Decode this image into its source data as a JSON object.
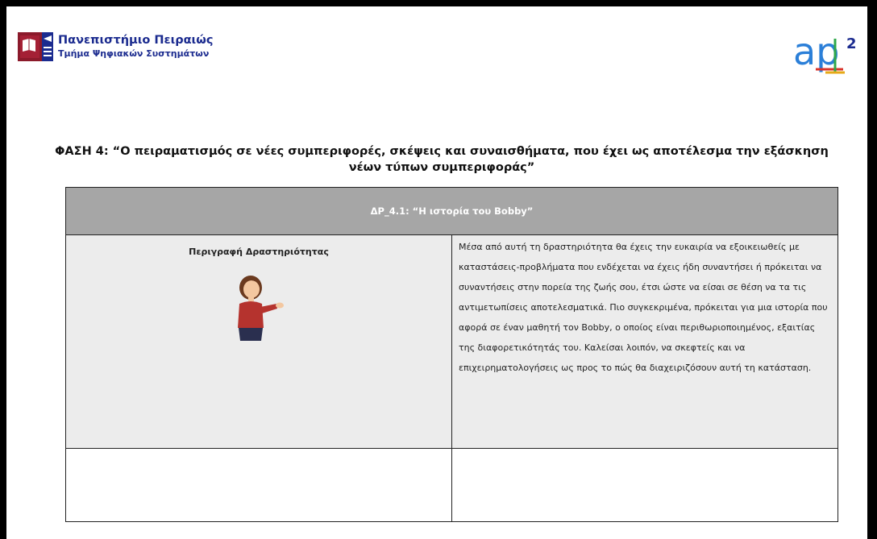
{
  "header": {
    "university_name": "Πανεπιστήμιο Πειραιώς",
    "department": "Τμήμα Ψηφιακών Συστημάτων",
    "apt_logo_text": "ap",
    "apt_logo_exponent": "2"
  },
  "phase_title": "ΦΑΣΗ 4: “Ο πειραματισμός σε νέες συμπεριφορές, σκέψεις και συναισθήματα, που έχει ως αποτέλεσμα την εξάσκηση νέων τύπων συμπεριφοράς”",
  "activity": {
    "header": "ΔΡ_4.1: “Η ιστορία του Bobby”",
    "description_label": "Περιγραφή Δραστηριότητας",
    "description_text": "Μέσα από αυτή τη δραστηριότητα θα έχεις την ευκαιρία να εξοικειωθείς με καταστάσεις-προβλήματα που ενδέχεται να έχεις ήδη συναντήσει ή πρόκειται να συναντήσεις στην πορεία της ζωής σου, έτσι ώστε  να είσαι σε θέση να τα τις αντιμετωπίσεις αποτελεσματικά. Πιο συγκεκριμένα, πρόκειται για μια ιστορία που αφορά σε έναν μαθητή τον Bobby, ο οποίος είναι περιθωριοποιημένος, εξαιτίας της διαφορετικότητάς του. Καλείσαι λοιπόν, να σκεφτείς και να επιχειρηματολογήσεις ως προς το πώς θα διαχειριζόσουν αυτή τη κατάσταση."
  },
  "colors": {
    "header_gray": "#a6a6a6",
    "cell_gray": "#ececec",
    "brand_blue": "#1b2b8f",
    "crest_red": "#8b1a2b"
  },
  "icons": [
    "university-crest-icon",
    "apt2-logo-icon",
    "teacher-illustration-icon"
  ]
}
